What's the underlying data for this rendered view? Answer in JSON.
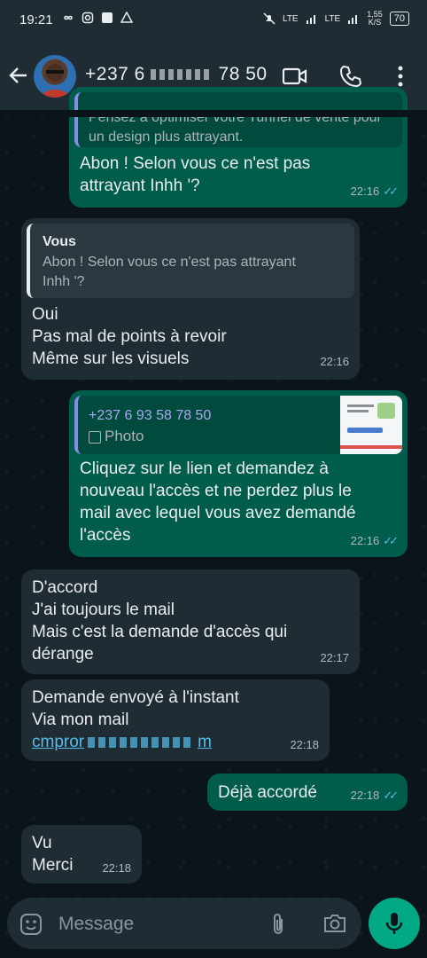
{
  "status_bar": {
    "time": "19:21",
    "net1": "LTE",
    "net2": "LTE",
    "speed_value": "1,55",
    "speed_unit": "K/S",
    "battery": "70"
  },
  "header": {
    "contact_name_visible": "+237 6",
    "contact_name_tail": "78 50"
  },
  "messages": [
    {
      "id": "m1",
      "direction": "out",
      "quote_text": "Pensez à optimiser votre Tunnel de vente pour un design plus attrayant.",
      "text_line1": "Abon ! Selon vous ce n'est pas",
      "text_line2": "attrayant Inhh '?",
      "time": "22:16",
      "ticks": "✓✓"
    },
    {
      "id": "m2",
      "direction": "in",
      "quote_name": "Vous",
      "quote_line1": "Abon ! Selon vous ce n'est pas attrayant",
      "quote_line2": "Inhh '?",
      "line1": "Oui",
      "line2": "Pas mal de points à revoir",
      "line3": "Même sur les visuels",
      "time": "22:16"
    },
    {
      "id": "m3",
      "direction": "out",
      "quote_name": "+237 6 93 58 78 50",
      "quote_media": "Photo",
      "line1": "Cliquez sur le lien et demandez à",
      "line2": "nouveau l'accès et ne perdez plus le",
      "line3": "mail avec lequel vous avez demandé",
      "line4": "l'accès",
      "time": "22:16",
      "ticks": "✓✓"
    },
    {
      "id": "m4",
      "direction": "in",
      "line1": "D'accord",
      "line2": "J'ai toujours le mail",
      "line3": "Mais c'est la demande d'accès qui",
      "line4": "dérange",
      "time": "22:17"
    },
    {
      "id": "m5",
      "direction": "in",
      "line1": "Demande envoyé à l'instant",
      "line2": "Via mon mail",
      "link_visible": "cmpror",
      "link_tail": "m",
      "time": "22:18"
    },
    {
      "id": "m6",
      "direction": "out",
      "text": "Déjà accordé",
      "time": "22:18",
      "ticks": "✓✓"
    },
    {
      "id": "m7",
      "direction": "in",
      "line1": "Vu",
      "line2": "Merci",
      "time": "22:18"
    }
  ],
  "composer": {
    "placeholder": "Message"
  },
  "colors": {
    "outgoing_bubble": "#005c4b",
    "incoming_bubble": "#1f2c33",
    "accent": "#00a884",
    "read_ticks": "#53bdeb"
  }
}
